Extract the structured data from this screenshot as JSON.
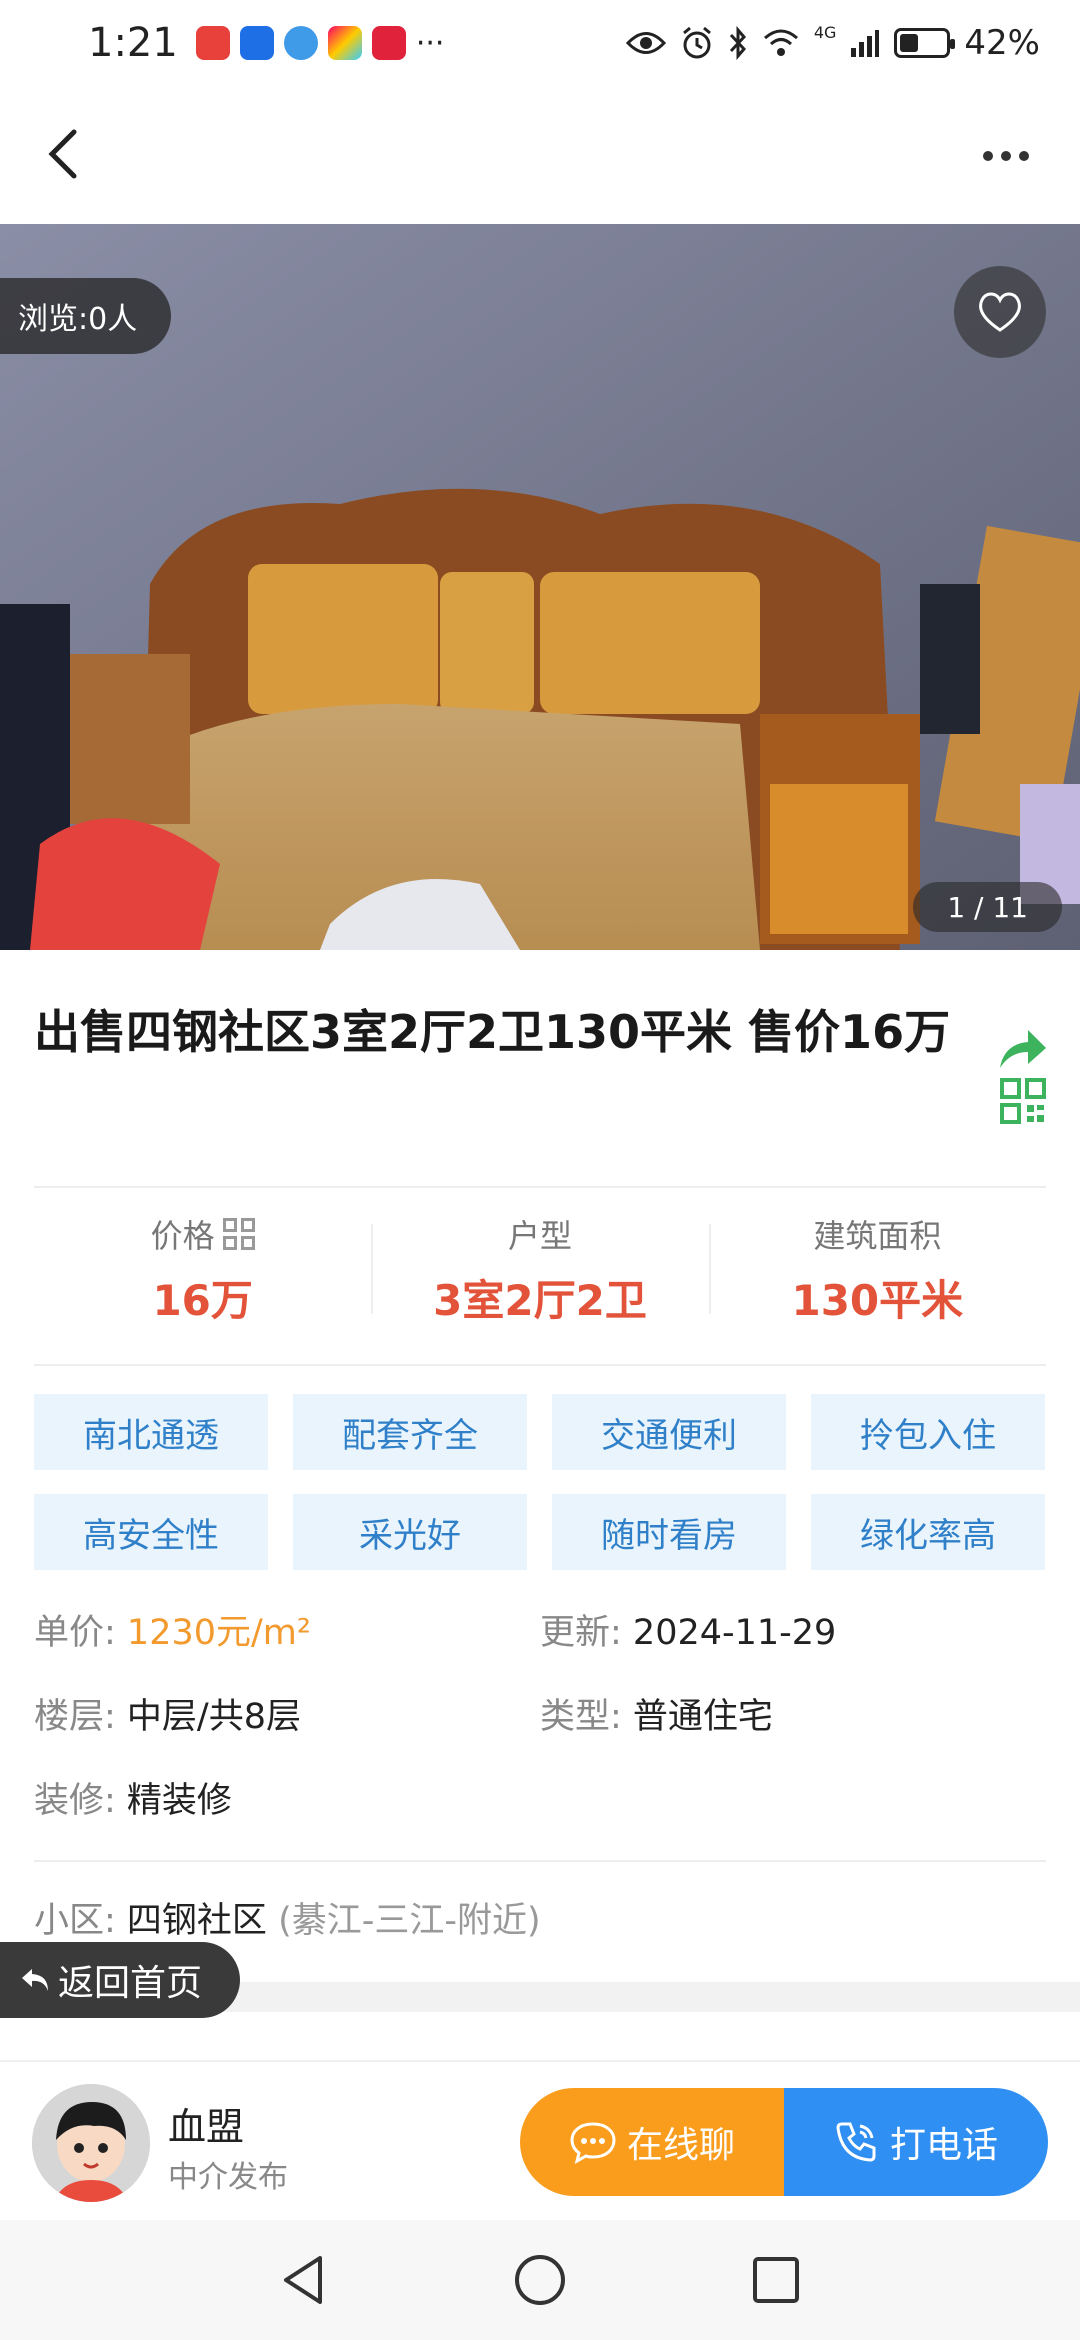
{
  "status_bar": {
    "time": "1:21",
    "overflow": "···",
    "network": "4G",
    "battery_percent": "42%",
    "battery_level": 0.42
  },
  "nav": {
    "back_icon": "chevron-left-icon",
    "more_icon": "more-dots-icon"
  },
  "gallery": {
    "views": "浏览:0人",
    "counter": "1 / 11",
    "favorite_icon": "heart-outline-icon"
  },
  "listing": {
    "title": "出售四钢社区3室2厅2卫130平米 售价16万",
    "stats": [
      {
        "label": "价格",
        "value": "16万"
      },
      {
        "label": "户型",
        "value": "3室2厅2卫"
      },
      {
        "label": "建筑面积",
        "value": "130平米"
      }
    ],
    "tags": [
      "南北通透",
      "配套齐全",
      "交通便利",
      "拎包入住",
      "高安全性",
      "采光好",
      "随时看房",
      "绿化率高"
    ],
    "details": {
      "unit_price_key": "单价: ",
      "unit_price_val": "1230元/m²",
      "updated_key": "更新: ",
      "updated_val": "2024-11-29",
      "floor_key": "楼层: ",
      "floor_val": "中层/共8层",
      "type_key": "类型: ",
      "type_val": "普通住宅",
      "decor_key": "装修: ",
      "decor_val": "精装修"
    },
    "community": {
      "key": "小区: ",
      "name": "四钢社区",
      "location": "(綦江-三江-附近)"
    }
  },
  "home_button": "返回首页",
  "agent": {
    "name": "血盟",
    "role": "中介发布"
  },
  "actions": {
    "chat": "在线聊",
    "call": "打电话"
  },
  "colors": {
    "price_red": "#e2533a",
    "tag_blue": "#2f80c9",
    "tag_bg": "#e9f4fd",
    "chat_orange": "#fa9d1c",
    "call_blue": "#2f8ff2",
    "share_green": "#3cb35c"
  }
}
